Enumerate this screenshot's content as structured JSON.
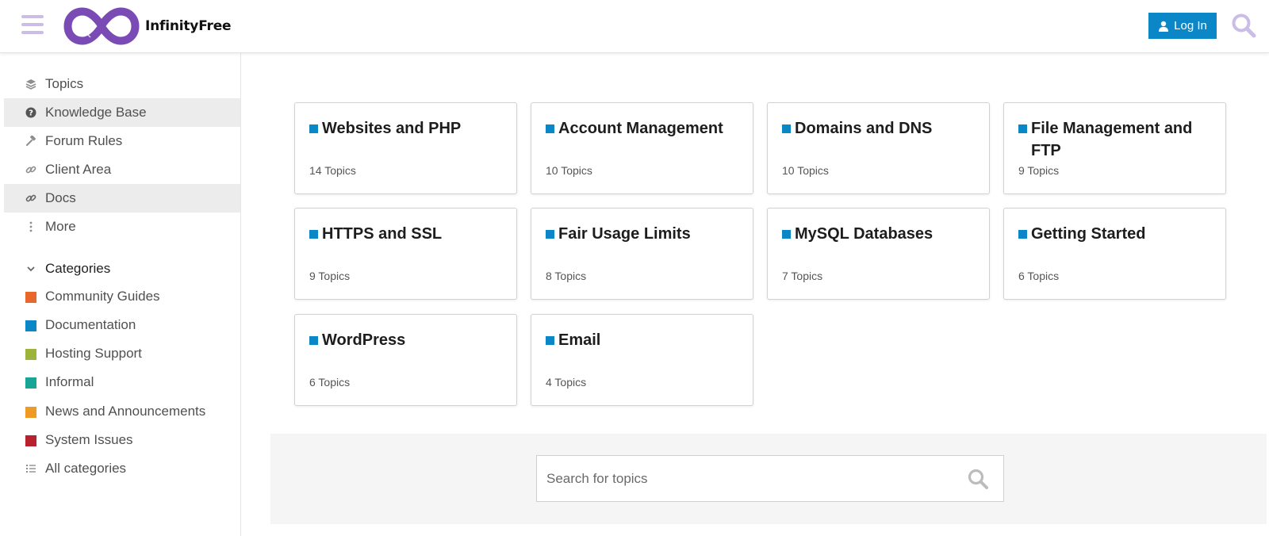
{
  "header": {
    "brand": "InfinityFree",
    "login_label": "Log In"
  },
  "sidebar": {
    "nav": [
      {
        "label": "Topics",
        "icon": "layers-icon",
        "active": false
      },
      {
        "label": "Knowledge Base",
        "icon": "question-circle-icon",
        "active": true
      },
      {
        "label": "Forum Rules",
        "icon": "gavel-icon",
        "active": false
      },
      {
        "label": "Client Area",
        "icon": "link-icon",
        "active": false
      },
      {
        "label": "Docs",
        "icon": "link-icon",
        "active": true
      },
      {
        "label": "More",
        "icon": "vertical-ellipsis-icon",
        "active": false
      }
    ],
    "categories_header": "Categories",
    "categories": [
      {
        "label": "Community Guides",
        "color": "#e8672a"
      },
      {
        "label": "Documentation",
        "color": "#0b86c6"
      },
      {
        "label": "Hosting Support",
        "color": "#9cb33c"
      },
      {
        "label": "Informal",
        "color": "#17a598"
      },
      {
        "label": "News and Announcements",
        "color": "#f09a26"
      },
      {
        "label": "System Issues",
        "color": "#b7222e"
      }
    ],
    "all_categories": "All categories"
  },
  "cards": [
    {
      "title": "Websites and PHP",
      "count": "14 Topics"
    },
    {
      "title": "Account Management",
      "count": "10 Topics"
    },
    {
      "title": "Domains and DNS",
      "count": "10 Topics"
    },
    {
      "title": "File Management and FTP",
      "count": "9 Topics"
    },
    {
      "title": "HTTPS and SSL",
      "count": "9 Topics"
    },
    {
      "title": "Fair Usage Limits",
      "count": "8 Topics"
    },
    {
      "title": "MySQL Databases",
      "count": "7 Topics"
    },
    {
      "title": "Getting Started",
      "count": "6 Topics"
    },
    {
      "title": "WordPress",
      "count": "6 Topics"
    },
    {
      "title": "Email",
      "count": "4 Topics"
    }
  ],
  "search": {
    "placeholder": "Search for topics"
  },
  "colors": {
    "accent": "#0b86c6",
    "brand_purple": "#7b4bb5"
  }
}
